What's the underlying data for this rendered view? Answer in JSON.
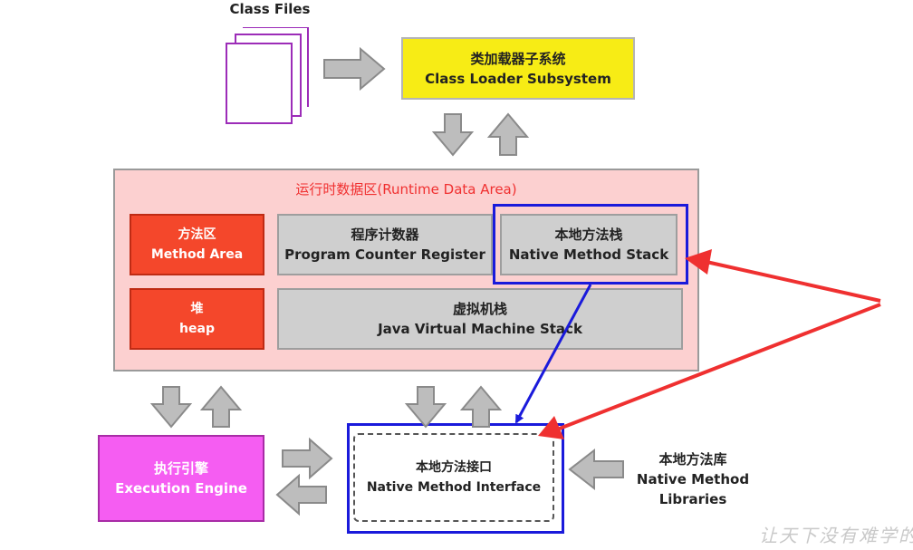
{
  "class_files": {
    "label": "Class Files"
  },
  "class_loader": {
    "zh": "类加载器子系统",
    "en": "Class Loader Subsystem"
  },
  "runtime_area": {
    "title": "运行时数据区(Runtime Data Area)"
  },
  "method_area": {
    "zh": "方法区",
    "en": "Method Area"
  },
  "pc_register": {
    "zh": "程序计数器",
    "en": "Program Counter Register"
  },
  "native_stack": {
    "zh": "本地方法栈",
    "en": "Native Method Stack"
  },
  "heap": {
    "zh": "堆",
    "en": "heap"
  },
  "jvm_stack": {
    "zh": "虚拟机栈",
    "en": "Java Virtual Machine Stack"
  },
  "exec_engine": {
    "zh": "执行引擎",
    "en": "Execution Engine"
  },
  "native_interface": {
    "zh": "本地方法接口",
    "en": "Native Method Interface"
  },
  "native_libs": {
    "zh": "本地方法库",
    "en1": "Native Method",
    "en2": "Libraries"
  },
  "watermark": {
    "text": "让天下没有难学的技术"
  },
  "colors": {
    "class_loader_fill": "#f7ec15",
    "runtime_fill": "#fcd0d0",
    "red_box": "#f4472b",
    "grey_box": "#cfcfcf",
    "engine_fill": "#f55df2",
    "highlight_blue": "#1a1adb",
    "pointer_red": "#ef3030",
    "file_stroke": "#9c2cb8"
  }
}
